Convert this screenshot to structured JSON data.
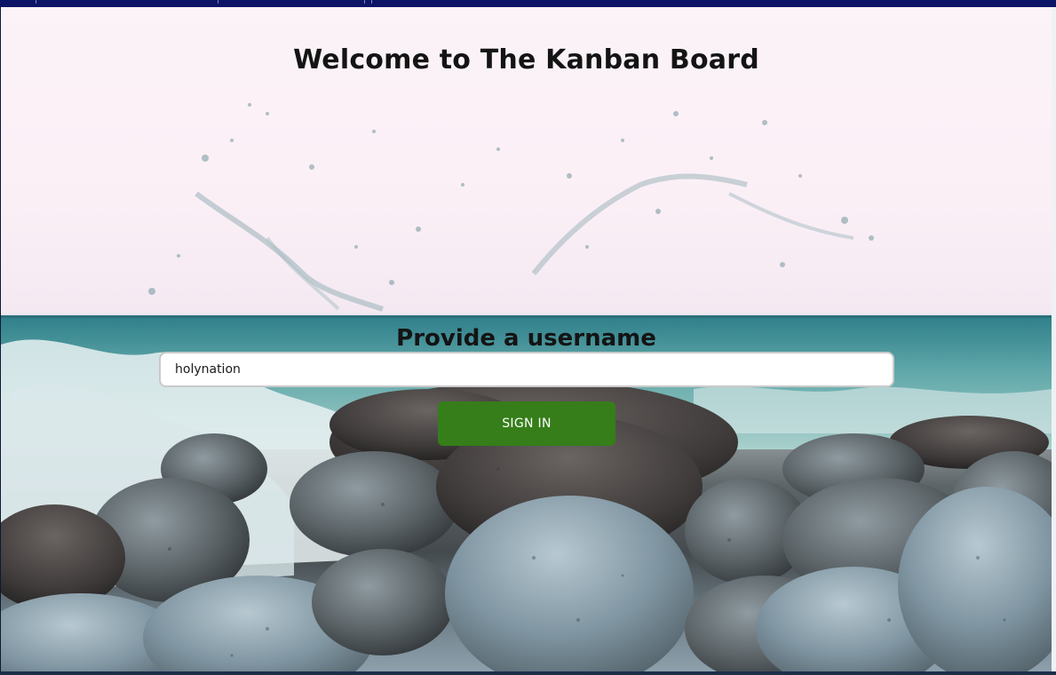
{
  "page": {
    "title": "Welcome to The Kanban Board"
  },
  "login_form": {
    "heading": "Provide a username",
    "username_value": "holynation",
    "sign_in_label": "SIGN IN"
  },
  "background": {
    "description_icon": "ocean-rocks-splash-image"
  },
  "colors": {
    "button": "#357e19",
    "title_text": "#141414",
    "top_bar": "#0b1466"
  }
}
